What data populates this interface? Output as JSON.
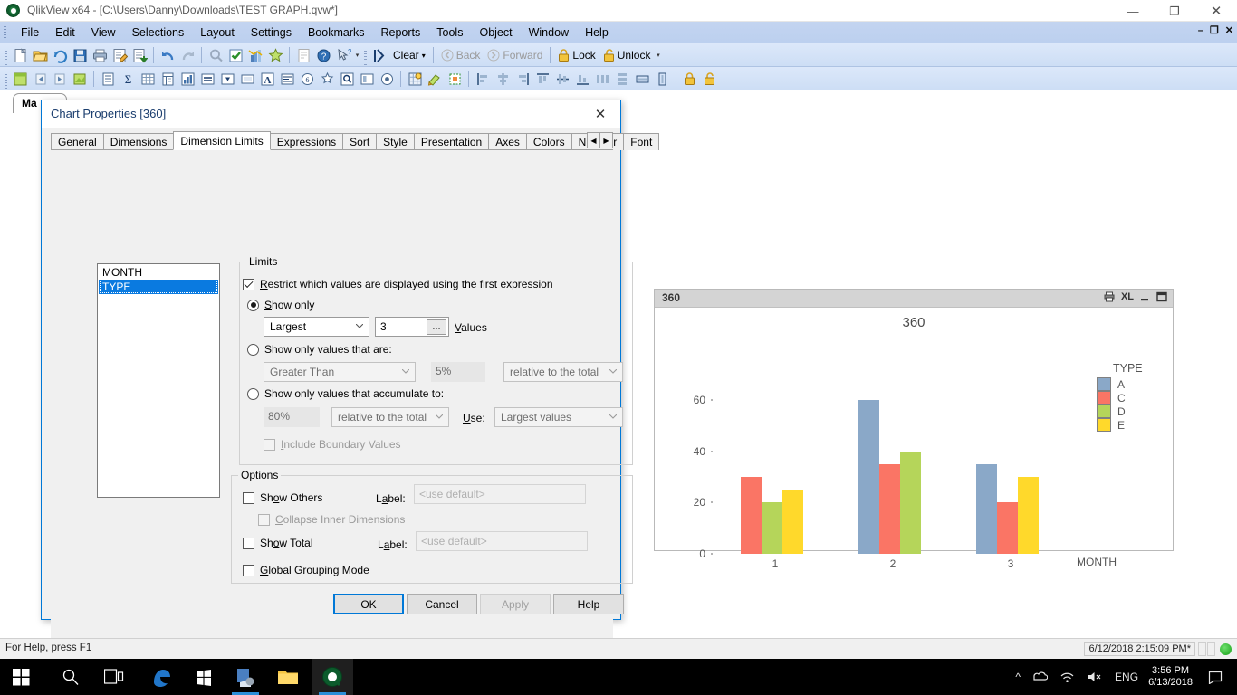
{
  "window": {
    "title": "QlikView x64 - [C:\\Users\\Danny\\Downloads\\TEST GRAPH.qvw*]",
    "minimize": "—",
    "maximize": "❐",
    "close": "✕",
    "mdi_minimize": "–",
    "mdi_restore": "❐",
    "mdi_close": "✕"
  },
  "menubar": {
    "items": [
      "File",
      "Edit",
      "View",
      "Selections",
      "Layout",
      "Settings",
      "Bookmarks",
      "Reports",
      "Tools",
      "Object",
      "Window",
      "Help"
    ]
  },
  "toolbar_row1": {
    "buttons": [
      "new-icon",
      "open-icon",
      "reload-icon",
      "save-icon",
      "print-icon",
      "edit-script-icon",
      "table-viewer-icon",
      "undo-icon",
      "redo-icon",
      "search-icon",
      "select-icon",
      "chart-icon",
      "favorite-icon",
      "note-icon",
      "help-icon",
      "help-pointer-icon"
    ],
    "clear_label": "Clear",
    "back_label": "Back",
    "forward_label": "Forward",
    "lock_label": "Lock",
    "unlock_label": "Unlock"
  },
  "toolbar_row2": {
    "buttons": [
      "sheet-icon",
      "prev-sheet-icon",
      "next-sheet-icon",
      "sheet-props-icon",
      "listbox-icon",
      "statistics-icon",
      "table-icon",
      "pivot-icon",
      "bar-chart-icon",
      "straight-table-icon",
      "multibox-icon",
      "input-box-icon",
      "text-object-icon",
      "current-selections-icon",
      "button-icon",
      "bookmark-object-icon",
      "search-object-icon",
      "container-icon",
      "slider-icon",
      "design-grid-icon",
      "theme-icon",
      "layout-icon",
      "align-left-icon",
      "align-center-icon",
      "align-right-icon",
      "align-top-icon",
      "align-middle-icon",
      "align-bottom-icon",
      "space-horizontal-icon",
      "space-vertical-icon",
      "size-width-icon",
      "size-height-icon",
      "lock-object-icon",
      "unlock-object-icon"
    ]
  },
  "sheet": {
    "tab_label": "Ma"
  },
  "chart_object": {
    "caption_title": "360",
    "caption_icons": [
      "print-icon",
      "export-xl-icon",
      "minimize-icon",
      "maximize-icon"
    ]
  },
  "chart_data": {
    "type": "bar",
    "title": "360",
    "xlabel": "MONTH",
    "ylabel": "",
    "categories": [
      "1",
      "2",
      "3"
    ],
    "yticks": [
      0,
      20,
      40,
      60
    ],
    "ylim": [
      0,
      65
    ],
    "grid": false,
    "legend_title": "TYPE",
    "legend_position": "right",
    "series": [
      {
        "name": "A",
        "color": "#8aa8c8",
        "values": [
          null,
          60,
          35
        ]
      },
      {
        "name": "C",
        "color": "#fa7565",
        "values": [
          30,
          35,
          20
        ]
      },
      {
        "name": "D",
        "color": "#b5d55a",
        "values": [
          20,
          40,
          null
        ]
      },
      {
        "name": "E",
        "color": "#ffd92b",
        "values": [
          25,
          null,
          30
        ]
      }
    ]
  },
  "dialog": {
    "title": "Chart Properties [360]",
    "close_icon": "✕",
    "tabs": [
      {
        "label": "General",
        "active": false
      },
      {
        "label": "Dimensions",
        "active": false
      },
      {
        "label": "Dimension Limits",
        "active": true
      },
      {
        "label": "Expressions",
        "active": false
      },
      {
        "label": "Sort",
        "active": false
      },
      {
        "label": "Style",
        "active": false
      },
      {
        "label": "Presentation",
        "active": false
      },
      {
        "label": "Axes",
        "active": false
      },
      {
        "label": "Colors",
        "active": false
      },
      {
        "label": "Number",
        "active": false
      },
      {
        "label": "Font",
        "active": false
      }
    ],
    "tab_prev": "◀",
    "tab_next": "▶",
    "dimension_list": [
      {
        "label": "MONTH",
        "selected": false
      },
      {
        "label": "TYPE",
        "selected": true
      }
    ],
    "limits": {
      "group_label": "Limits",
      "restrict_label": "Restrict which values are displayed using the first expression",
      "restrict_checked": true,
      "show_only_label": "Show only",
      "show_only_selected": true,
      "largest_combo_value": "Largest",
      "values_count": "3",
      "ellipsis_label": "...",
      "values_label": "Values",
      "show_only_values_that_are_label": "Show only values that are:",
      "greater_than_value": "Greater Than",
      "percent_value": "5%",
      "relative_to_total_value": "relative to the total",
      "accumulate_label": "Show only values that accumulate to:",
      "accumulate_percent": "80%",
      "accumulate_relative": "relative to the total",
      "use_label": "Use:",
      "use_value": "Largest values",
      "include_boundary_label": "Include Boundary Values",
      "include_boundary_checked": false
    },
    "options": {
      "group_label": "Options",
      "show_others_label": "Show Others",
      "show_others_checked": false,
      "show_others_label_caption": "Label:",
      "show_others_label_value": "<use default>",
      "collapse_inner_label": "Collapse Inner Dimensions",
      "collapse_inner_checked": false,
      "show_total_label": "Show Total",
      "show_total_checked": false,
      "show_total_label_caption": "Label:",
      "show_total_label_value": "<use default>",
      "global_grouping_label": "Global Grouping Mode",
      "global_grouping_checked": false
    },
    "buttons": {
      "ok": "OK",
      "cancel": "Cancel",
      "apply": "Apply",
      "help": "Help"
    }
  },
  "statusbar": {
    "help_text": "For Help, press F1",
    "timestamp": "6/12/2018 2:15:09 PM*"
  },
  "taskbar": {
    "items": [
      "start-icon",
      "search-icon",
      "task-view-icon",
      "edge-icon",
      "store-icon",
      "app-icon",
      "file-explorer-icon",
      "qlikview-icon"
    ],
    "tray": [
      "chevron-up-icon",
      "onedrive-icon",
      "network-icon",
      "volume-mute-icon"
    ],
    "language": "ENG",
    "time": "3:56 PM",
    "date": "6/13/2018",
    "action_center": "action-center-icon"
  }
}
